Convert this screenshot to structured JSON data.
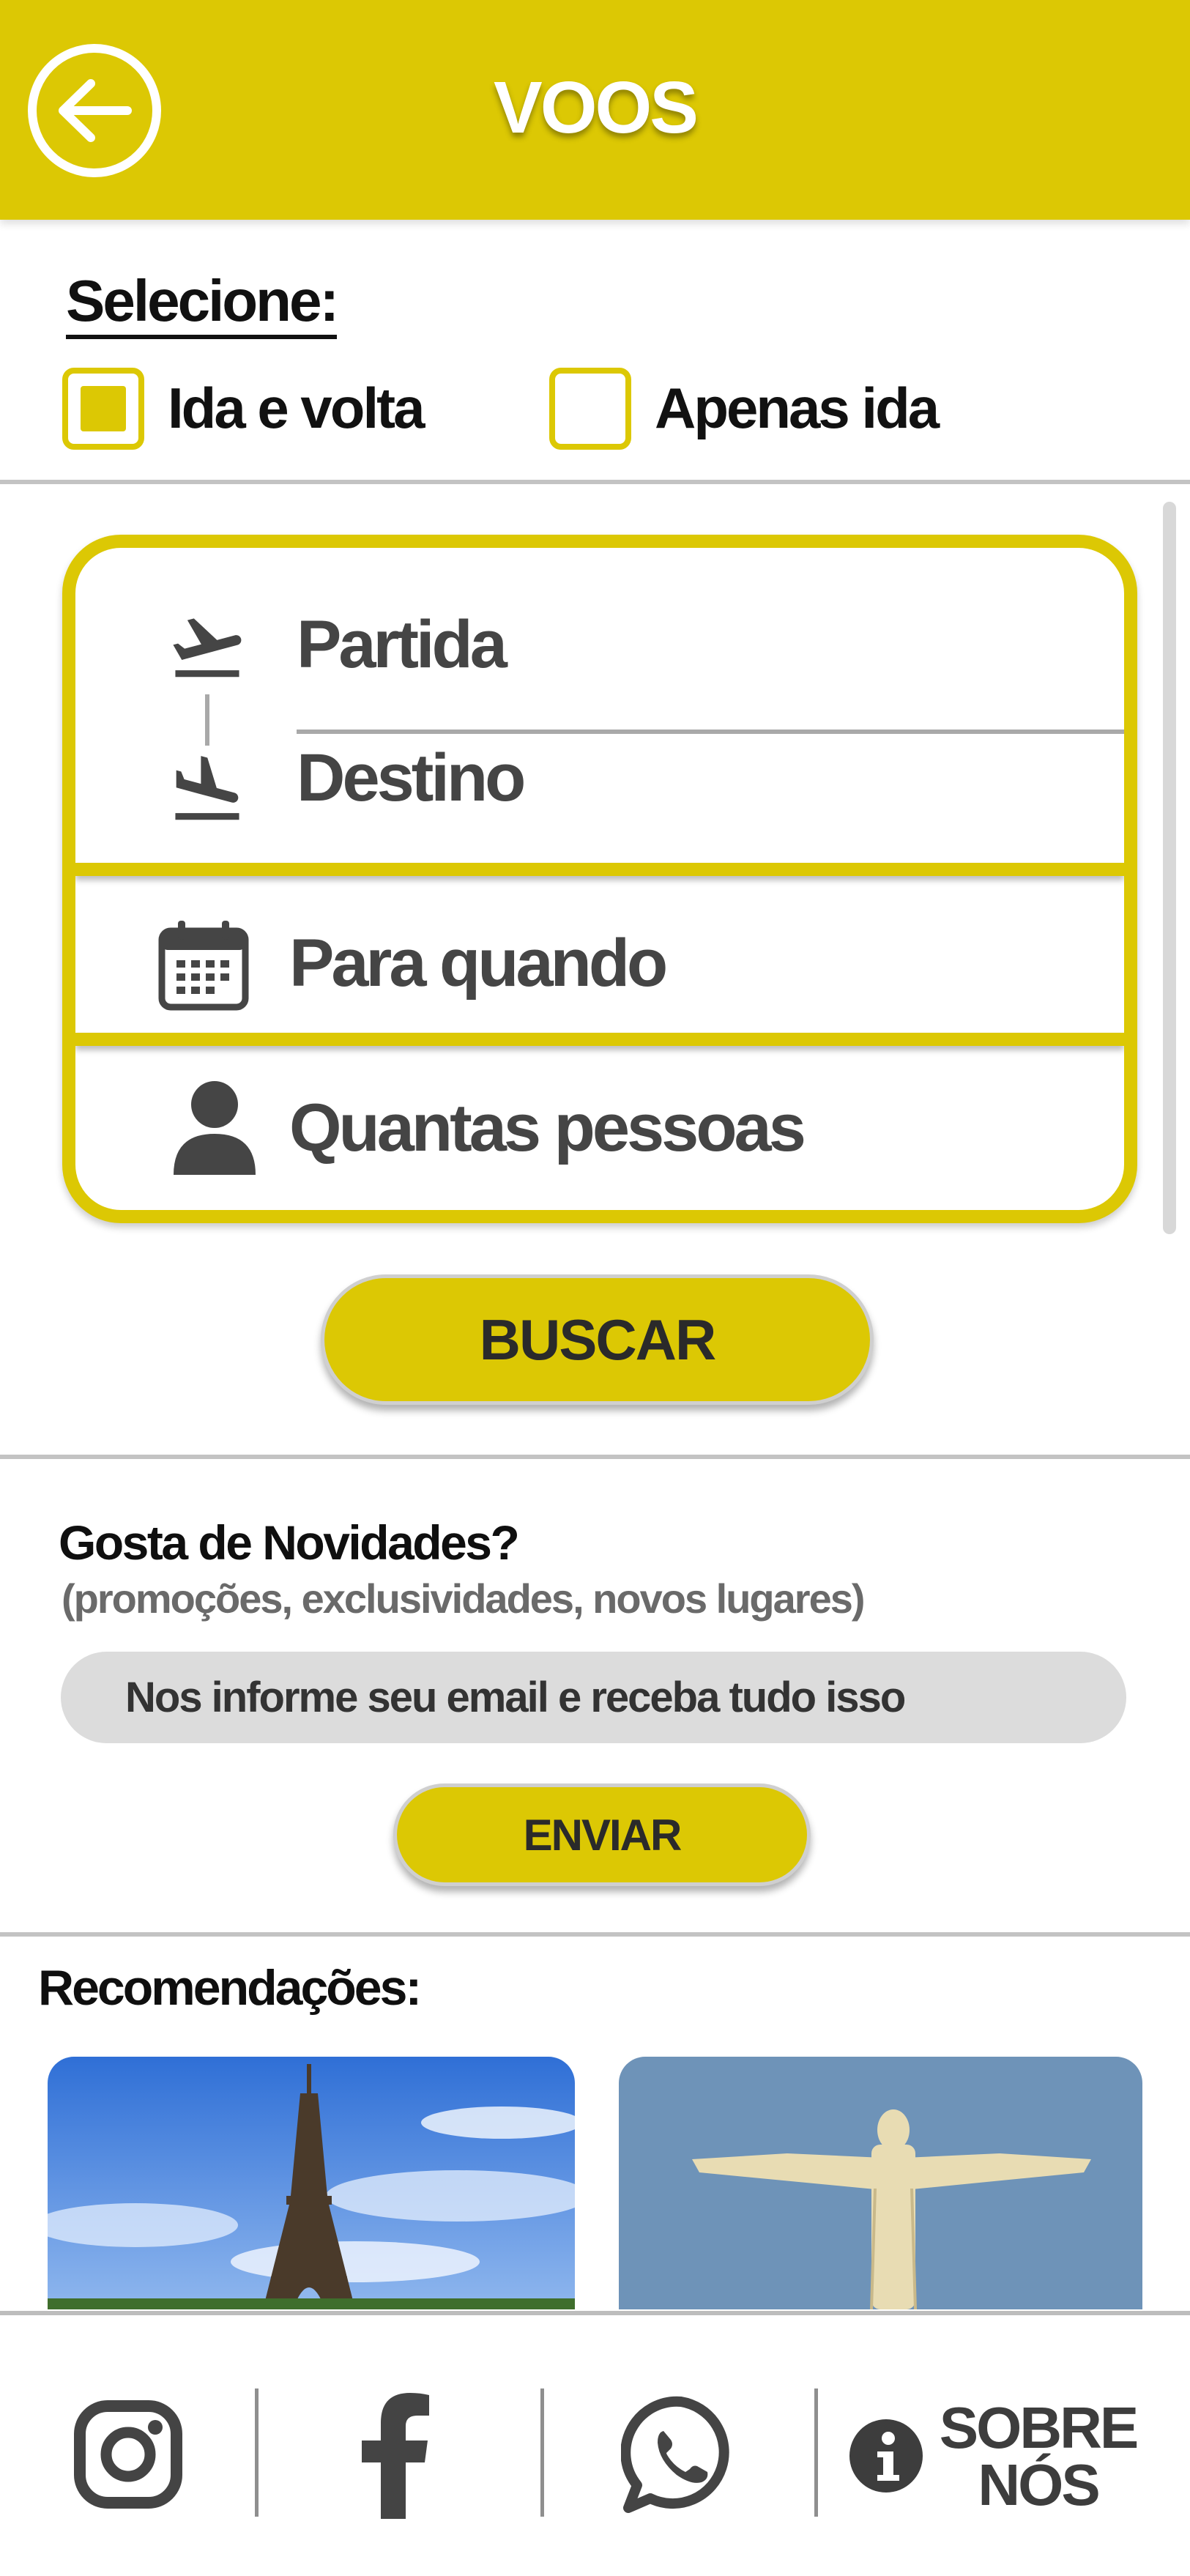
{
  "header": {
    "title": "VOOS",
    "back_icon": "arrow-left-circle-icon"
  },
  "trip_type": {
    "title": "Selecione:",
    "options": [
      {
        "label": "Ida e volta",
        "checked": true
      },
      {
        "label": "Apenas ida",
        "checked": false
      }
    ]
  },
  "form": {
    "origin_placeholder": "Partida",
    "destination_placeholder": "Destino",
    "date_placeholder": "Para quando",
    "passengers_placeholder": "Quantas pessoas"
  },
  "search_button": "BUSCAR",
  "newsletter": {
    "title": "Gosta de Novidades?",
    "subtitle": "(promoções, exclusividades, novos lugares)",
    "email_placeholder": "Nos informe seu email e receba tudo isso",
    "send_button": "ENVIAR"
  },
  "recommendations": {
    "title": "Recomendações:",
    "items": [
      {
        "image": "eiffel-tower-photo"
      },
      {
        "image": "christ-the-redeemer-photo"
      }
    ]
  },
  "bottom_nav": {
    "items": [
      {
        "icon": "instagram-icon"
      },
      {
        "icon": "facebook-icon"
      },
      {
        "icon": "whatsapp-icon"
      },
      {
        "icon": "info-icon",
        "label_line1": "SOBRE",
        "label_line2": "NÓS"
      }
    ]
  },
  "colors": {
    "brand": "#dcc804",
    "text_dark": "#454545",
    "divider": "#c3c3c3"
  }
}
